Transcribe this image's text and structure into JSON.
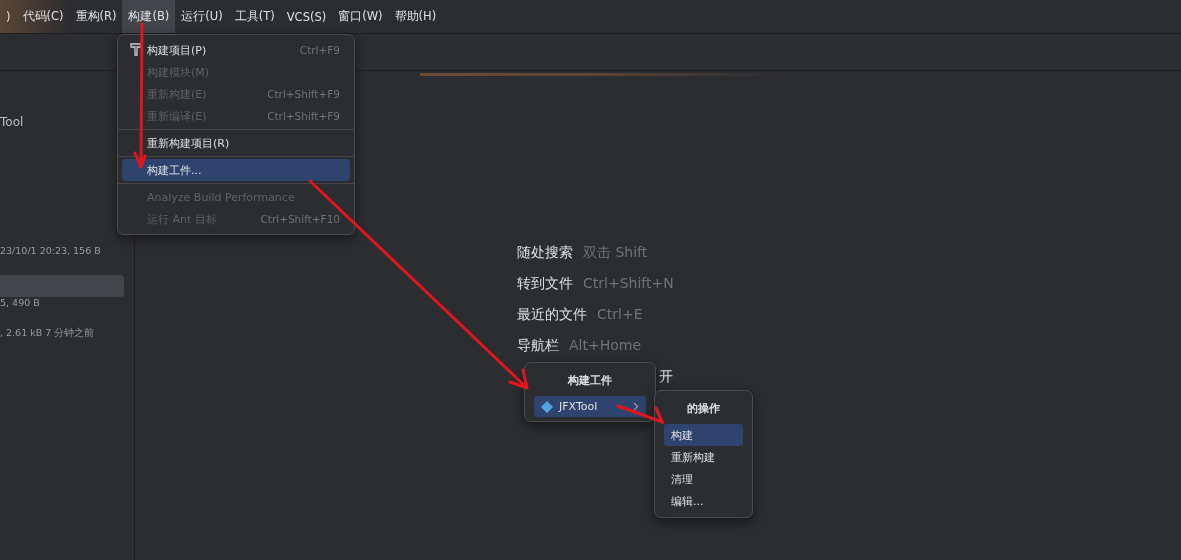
{
  "menubar": [
    {
      "label": ")",
      "selected": false
    },
    {
      "label": "代码(C)",
      "selected": false
    },
    {
      "label": "重构(R)",
      "selected": false
    },
    {
      "label": "构建(B)",
      "selected": true
    },
    {
      "label": "运行(U)",
      "selected": false
    },
    {
      "label": "工具(T)",
      "selected": false
    },
    {
      "label": "VCS(S)",
      "selected": false
    },
    {
      "label": "窗口(W)",
      "selected": false
    },
    {
      "label": "帮助(H)",
      "selected": false
    }
  ],
  "build_menu": [
    {
      "kind": "icon-item",
      "label": "构建项目(P)",
      "shortcut": "Ctrl+F9",
      "disabled": false,
      "selected": false
    },
    {
      "kind": "item",
      "label": "构建模块(M)",
      "disabled": true,
      "selected": false
    },
    {
      "kind": "item",
      "label": "重新构建(E)",
      "shortcut": "Ctrl+Shift+F9",
      "disabled": true,
      "selected": false
    },
    {
      "kind": "item",
      "label": "重新编译(E)",
      "shortcut": "Ctrl+Shift+F9",
      "disabled": true,
      "selected": false
    },
    {
      "kind": "separator"
    },
    {
      "kind": "item",
      "label": "重新构建项目(R)",
      "disabled": false,
      "selected": false
    },
    {
      "kind": "separator"
    },
    {
      "kind": "item",
      "label": "构建工件...",
      "disabled": false,
      "selected": true
    },
    {
      "kind": "separator"
    },
    {
      "kind": "item",
      "label": "Analyze Build Performance",
      "disabled": true,
      "selected": false
    },
    {
      "kind": "item",
      "label": "运行 Ant 目标",
      "shortcut": "Ctrl+Shift+F10",
      "disabled": true,
      "selected": false
    }
  ],
  "project_panel": {
    "items": [
      {
        "kind": "title",
        "text": "Tool",
        "selected": false
      },
      {
        "kind": "meta",
        "text": "23/10/1 20:23, 156 B",
        "selected": false
      },
      {
        "kind": "blank",
        "selected": true
      },
      {
        "kind": "meta",
        "text": "5, 490 B",
        "selected": false
      },
      {
        "kind": "meta",
        "text": ", 2.61 kB 7 分钟之前",
        "selected": false
      }
    ]
  },
  "welcome_hints": [
    {
      "kind": "full",
      "label": "随处搜索",
      "shortcut": "双击 Shift"
    },
    {
      "kind": "full",
      "label": "转到文件",
      "shortcut": "Ctrl+Shift+N"
    },
    {
      "kind": "full",
      "label": "最近的文件",
      "shortcut": "Ctrl+E"
    },
    {
      "kind": "full",
      "label": "导航栏",
      "shortcut": "Alt+Home"
    },
    {
      "kind": "tail",
      "label": "开"
    }
  ],
  "artifacts_popup": {
    "title": "构建工件",
    "items": [
      {
        "label": "JFXTool",
        "selected": true
      }
    ]
  },
  "actions_popup": {
    "title": "的操作",
    "items": [
      {
        "label": "构建",
        "selected": true
      },
      {
        "label": "重新构建",
        "selected": false
      },
      {
        "label": "清理",
        "selected": false
      },
      {
        "label": "编辑...",
        "selected": false
      }
    ]
  }
}
